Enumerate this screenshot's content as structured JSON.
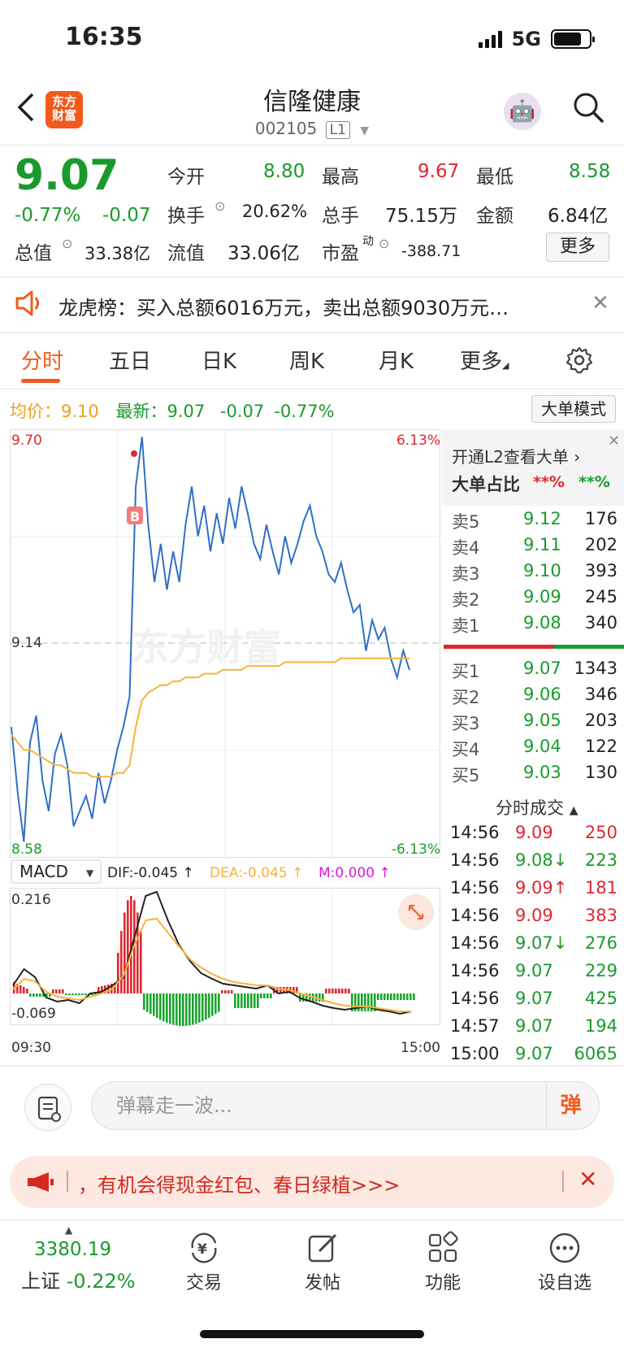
{
  "status_bar": {
    "time": "16:35",
    "network": "5G"
  },
  "header": {
    "back_icon": "chevron-left-icon",
    "logo_text_top": "东方",
    "logo_text_bottom": "财富",
    "stock_name": "信隆健康",
    "stock_code": "002105",
    "level": "L1"
  },
  "quote": {
    "price": "9.07",
    "change_pct": "-0.77%",
    "change": "-0.07",
    "open_label": "今开",
    "open": "8.80",
    "high_label": "最高",
    "high": "9.67",
    "low_label": "最低",
    "low": "8.58",
    "turnover_rate_label": "换手",
    "turnover_rate": "20.62%",
    "volume_label": "总手",
    "volume": "75.15万",
    "amount_label": "金额",
    "amount": "6.84亿",
    "market_cap_label": "总值",
    "market_cap": "33.38亿",
    "float_cap_label": "流值",
    "float_cap": "33.06亿",
    "pe_label": "市盈",
    "pe_sup": "动",
    "pe": "-388.71",
    "more_button": "更多"
  },
  "notice": {
    "text": "龙虎榜：买入总额6016万元，卖出总额9030万元…"
  },
  "tabs": [
    "分时",
    "五日",
    "日K",
    "周K",
    "月K",
    "更多"
  ],
  "info_line": {
    "avg_label": "均价：",
    "avg": "9.10",
    "latest_label": "最新：",
    "latest": "9.07",
    "latest_change": "-0.07",
    "latest_pct": "-0.77%",
    "big_order_mode": "大单模式"
  },
  "chart_labels": {
    "y_max": "9.70",
    "y_mid": "9.14",
    "y_min": "8.58",
    "pct_max": "6.13%",
    "pct_min": "-6.13%",
    "marker": "B",
    "watermark": "东方财富",
    "macd_select": "MACD",
    "dif": "DIF:-0.045 ↑",
    "dea": "DEA:-0.045 ↑",
    "m": "M:0.000 ↑",
    "macd_max": "0.216",
    "macd_min": "-0.069",
    "time_start": "09:30",
    "time_end": "15:00"
  },
  "chart_data": {
    "type": "line",
    "x_range": [
      "09:30",
      "15:00"
    ],
    "ylim": [
      8.58,
      9.7
    ],
    "series": [
      {
        "name": "price",
        "color": "#2f6fc7",
        "values": [
          8.92,
          8.75,
          8.62,
          8.88,
          8.95,
          8.78,
          8.7,
          8.85,
          8.9,
          8.82,
          8.66,
          8.7,
          8.74,
          8.68,
          8.8,
          8.72,
          8.78,
          8.86,
          8.92,
          9.0,
          9.55,
          9.68,
          9.45,
          9.3,
          9.4,
          9.28,
          9.38,
          9.3,
          9.45,
          9.55,
          9.42,
          9.5,
          9.38,
          9.48,
          9.4,
          9.52,
          9.44,
          9.55,
          9.48,
          9.4,
          9.36,
          9.45,
          9.38,
          9.32,
          9.42,
          9.35,
          9.4,
          9.46,
          9.5,
          9.42,
          9.38,
          9.32,
          9.3,
          9.35,
          9.28,
          9.22,
          9.24,
          9.12,
          9.2,
          9.15,
          9.18,
          9.1,
          9.05,
          9.12,
          9.07
        ]
      },
      {
        "name": "avg",
        "color": "#f6b33c",
        "values": [
          8.9,
          8.88,
          8.86,
          8.86,
          8.85,
          8.84,
          8.83,
          8.82,
          8.82,
          8.81,
          8.8,
          8.8,
          8.8,
          8.79,
          8.79,
          8.79,
          8.79,
          8.8,
          8.8,
          8.82,
          8.92,
          8.99,
          9.01,
          9.02,
          9.03,
          9.03,
          9.04,
          9.04,
          9.05,
          9.05,
          9.05,
          9.06,
          9.06,
          9.06,
          9.07,
          9.07,
          9.07,
          9.07,
          9.08,
          9.08,
          9.08,
          9.08,
          9.08,
          9.08,
          9.09,
          9.09,
          9.09,
          9.09,
          9.09,
          9.09,
          9.09,
          9.09,
          9.09,
          9.1,
          9.1,
          9.1,
          9.1,
          9.1,
          9.1,
          9.1,
          9.1,
          9.1,
          9.1,
          9.1,
          9.1
        ]
      }
    ]
  },
  "order_book": {
    "promo": "开通L2查看大单",
    "ratio_label": "大单占比",
    "ratio_red": "**%",
    "ratio_green": "**%",
    "asks": [
      {
        "label": "卖5",
        "price": "9.12",
        "vol": "176"
      },
      {
        "label": "卖4",
        "price": "9.11",
        "vol": "202"
      },
      {
        "label": "卖3",
        "price": "9.10",
        "vol": "393"
      },
      {
        "label": "卖2",
        "price": "9.09",
        "vol": "245"
      },
      {
        "label": "卖1",
        "price": "9.08",
        "vol": "340"
      }
    ],
    "bids": [
      {
        "label": "买1",
        "price": "9.07",
        "vol": "1343"
      },
      {
        "label": "买2",
        "price": "9.06",
        "vol": "346"
      },
      {
        "label": "买3",
        "price": "9.05",
        "vol": "203"
      },
      {
        "label": "买4",
        "price": "9.04",
        "vol": "122"
      },
      {
        "label": "买5",
        "price": "9.03",
        "vol": "130"
      }
    ],
    "trades_title": "分时成交",
    "trades": [
      {
        "time": "14:56",
        "price": "9.09",
        "vol": "250",
        "color": "red"
      },
      {
        "time": "14:56",
        "price": "9.08↓",
        "vol": "223",
        "color": "green"
      },
      {
        "time": "14:56",
        "price": "9.09↑",
        "vol": "181",
        "color": "red"
      },
      {
        "time": "14:56",
        "price": "9.09",
        "vol": "383",
        "color": "red"
      },
      {
        "time": "14:56",
        "price": "9.07↓",
        "vol": "276",
        "color": "green"
      },
      {
        "time": "14:56",
        "price": "9.07",
        "vol": "229",
        "color": "green"
      },
      {
        "time": "14:56",
        "price": "9.07",
        "vol": "425",
        "color": "green"
      },
      {
        "time": "14:57",
        "price": "9.07",
        "vol": "194",
        "color": "green"
      },
      {
        "time": "15:00",
        "price": "9.07",
        "vol": "6065",
        "color": "green"
      }
    ]
  },
  "comment_bar": {
    "placeholder": "弹幕走一波...",
    "danmu_button": "弹"
  },
  "promo_banner": {
    "text": "，有机会得现金红包、春日绿植>>>"
  },
  "bottom_nav": {
    "index_value": "3380.19",
    "index_name": "上证",
    "index_change": "-0.22%",
    "items": [
      "交易",
      "发帖",
      "功能",
      "设自选"
    ]
  }
}
